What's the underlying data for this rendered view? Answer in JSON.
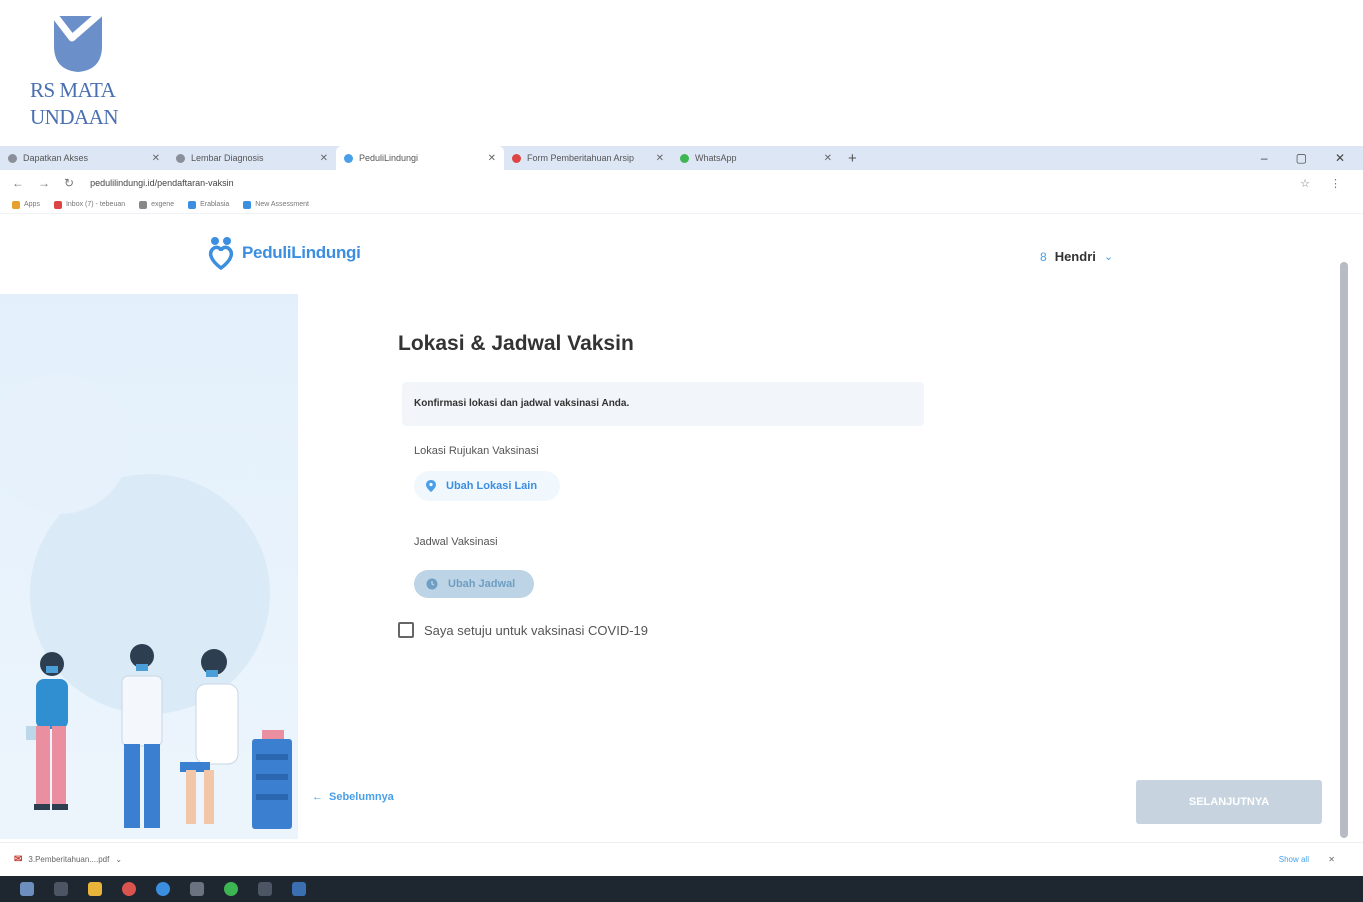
{
  "hospital_logo": {
    "line1": "RS MATA",
    "line2": "UNDAAN",
    "color": "#4a6fb0"
  },
  "browser": {
    "tabs": [
      {
        "label": "Dapatkan Akses",
        "color": "#8a8f99"
      },
      {
        "label": "Lembar Diagnosis",
        "color": "#8a8f99"
      },
      {
        "label": "PeduliLindungi",
        "color": "#4aa0e8",
        "active": true
      },
      {
        "label": "Form Pemberitahuan Arsip",
        "color": "#d44"
      },
      {
        "label": "WhatsApp",
        "color": "#3db552"
      }
    ],
    "new_tab": "+",
    "window_controls": [
      "–",
      "▢",
      "✕"
    ],
    "nav": [
      "←",
      "→",
      "↻"
    ],
    "url": "pedulilindungi.id/pendaftaran-vaksin",
    "address_icons": [
      "☆",
      "⋮"
    ],
    "bookmarks": [
      {
        "label": "Apps",
        "color": "#e5a02e"
      },
      {
        "label": "Inbox (7) - tebeuan",
        "color": "#d44"
      },
      {
        "label": "exgene",
        "color": "#888"
      },
      {
        "label": "Erablasia",
        "color": "#3b8ee0"
      },
      {
        "label": "New Assessment",
        "color": "#3b8ee0"
      }
    ]
  },
  "site": {
    "brand": "PeduliLindungi",
    "user": {
      "icon": "8",
      "name": "Hendri",
      "chevron": "⌄"
    }
  },
  "form": {
    "title": "Lokasi & Jadwal Vaksin",
    "info": "Konfirmasi lokasi dan jadwal vaksinasi Anda.",
    "location_label": "Lokasi Rujukan Vaksinasi",
    "location_button": "Ubah Lokasi Lain",
    "schedule_label": "Jadwal Vaksinasi",
    "schedule_button": "Ubah Jadwal",
    "consent": "Saya setuju untuk vaksinasi COVID-19",
    "prev": "Sebelumnya",
    "prev_arrow": "←",
    "next": "SELANJUTNYA"
  },
  "downloads": {
    "file": "3.Pemberitahuan....pdf",
    "show_all": "Show all",
    "close": "✕"
  },
  "colors": {
    "accent": "#3b8ee0",
    "disabled_button": "#c7d4e0"
  }
}
